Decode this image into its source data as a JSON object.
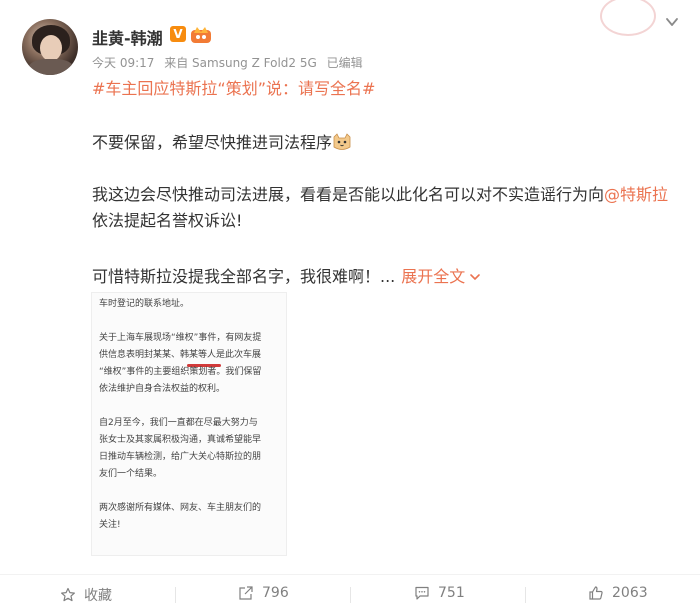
{
  "post": {
    "username": "韭黄-韩潮",
    "verified_badge": "V",
    "meta": {
      "time": "今天 09:17",
      "source": "来自 Samsung Z Fold2 5G",
      "edited": "已编辑"
    },
    "topic": "#车主回应特斯拉“策划”说：请写全名#",
    "paragraph1": "不要保留，希望尽快推进司法程序",
    "paragraph2_prefix": "我这边会尽快推动司法进展，看看是否能以此化名可以对不实造谣行为向",
    "paragraph2_mention": "@特斯拉",
    "paragraph2_suffix": " 依法提起名誉权诉讼!",
    "paragraph3": "可惜特斯拉没提我全部名字，我很难啊！...",
    "expand_label": "展开全文"
  },
  "document_image": {
    "lines": [
      "车时登记的联系地址。",
      "关于上海车展现场“维权”事件，有网友提",
      "供信息表明封某某、韩某等人是此次车展",
      "“维权”事件的主要组织策划者。我们保留",
      "依法维护自身合法权益的权利。",
      "自2月至今，我们一直都在尽最大努力与",
      "张女士及其家属积极沟通，真诚希望能早",
      "日推动车辆检测，给广大关心特斯拉的朋",
      "友们一个结果。",
      "两次感谢所有媒体、网友、车主朋友们的",
      "关注!"
    ]
  },
  "actions": {
    "favorite_label": "收藏",
    "repost_count": "796",
    "comment_count": "751",
    "like_count": "2063"
  },
  "colors": {
    "accent": "#eb7350",
    "badge": "#f78c0f",
    "muted": "#939393"
  }
}
